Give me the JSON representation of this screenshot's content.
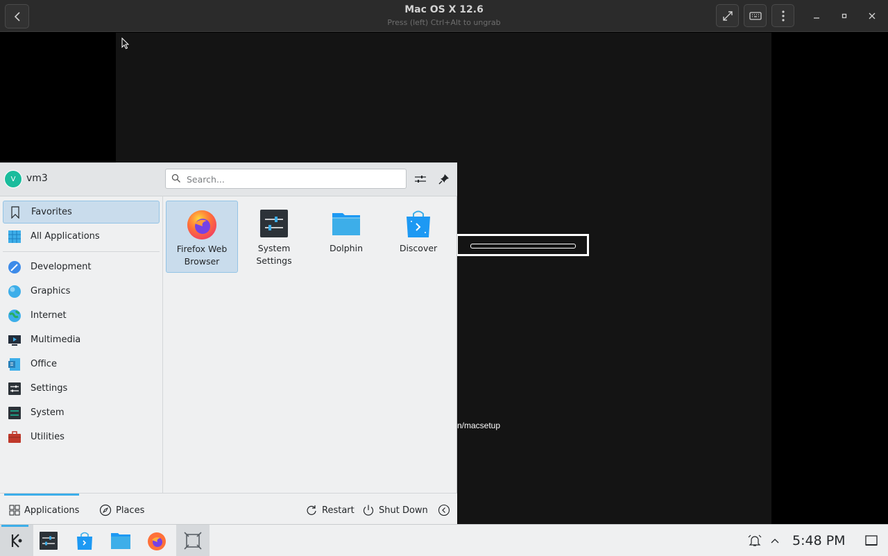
{
  "vm": {
    "title": "Mac OS X 12.6",
    "subtitle": "Press (left) Ctrl+Alt to ungrab"
  },
  "guest": {
    "partial_text": "n/macsetup"
  },
  "launcher": {
    "user": {
      "initial": "V",
      "name": "vm3"
    },
    "search": {
      "placeholder": "Search...",
      "value": ""
    },
    "categories": [
      {
        "label": "Favorites",
        "icon": "bookmark-icon",
        "selected": true
      },
      {
        "label": "All Applications",
        "icon": "grid-icon",
        "selected": false
      },
      {
        "label": "Development",
        "icon": "development-icon",
        "selected": false
      },
      {
        "label": "Graphics",
        "icon": "graphics-icon",
        "selected": false
      },
      {
        "label": "Internet",
        "icon": "globe-icon",
        "selected": false
      },
      {
        "label": "Multimedia",
        "icon": "multimedia-icon",
        "selected": false
      },
      {
        "label": "Office",
        "icon": "office-icon",
        "selected": false
      },
      {
        "label": "Settings",
        "icon": "settings-icon",
        "selected": false
      },
      {
        "label": "System",
        "icon": "system-icon",
        "selected": false
      },
      {
        "label": "Utilities",
        "icon": "utilities-icon",
        "selected": false
      }
    ],
    "favorites": [
      {
        "label": "Firefox Web Browser",
        "icon": "firefox-icon",
        "selected": true
      },
      {
        "label": "System Settings",
        "icon": "system-settings-icon",
        "selected": false
      },
      {
        "label": "Dolphin",
        "icon": "folder-icon",
        "selected": false
      },
      {
        "label": "Discover",
        "icon": "discover-icon",
        "selected": false
      }
    ],
    "footer": {
      "applications": "Applications",
      "places": "Places",
      "restart": "Restart",
      "shutdown": "Shut Down"
    }
  },
  "taskbar": {
    "clock": "5:48 PM"
  },
  "colors": {
    "accent": "#3daee9",
    "selection": "#c9dcec",
    "panel": "#eff0f1",
    "vm_bar": "#2b2b2b"
  }
}
